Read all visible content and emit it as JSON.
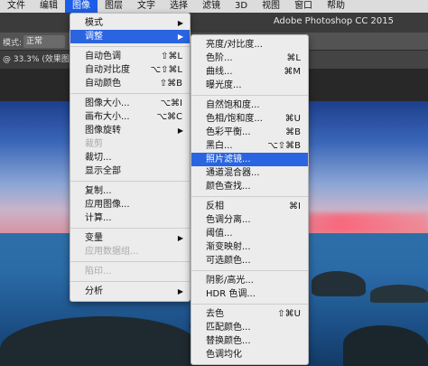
{
  "menubar": {
    "items": [
      "文件",
      "编辑",
      "图像",
      "图层",
      "文字",
      "选择",
      "滤镜",
      "3D",
      "视图",
      "窗口",
      "帮助"
    ],
    "active_index": 2
  },
  "app": {
    "title": "Adobe Photoshop CC 2015"
  },
  "options_bar": {
    "mode_label": "模式:",
    "mode_value": "正常"
  },
  "document_tab": {
    "label": "@ 33.3% (效果图层"
  },
  "image_menu": {
    "items": [
      {
        "label": "模式",
        "submenu": true
      },
      {
        "label": "调整",
        "submenu": true,
        "selected": true
      },
      {
        "sep": true
      },
      {
        "label": "自动色调",
        "shortcut": "⇧⌘L"
      },
      {
        "label": "自动对比度",
        "shortcut": "⌥⇧⌘L"
      },
      {
        "label": "自动颜色",
        "shortcut": "⇧⌘B"
      },
      {
        "sep": true
      },
      {
        "label": "图像大小...",
        "shortcut": "⌥⌘I"
      },
      {
        "label": "画布大小...",
        "shortcut": "⌥⌘C"
      },
      {
        "label": "图像旋转",
        "submenu": true
      },
      {
        "label": "裁剪",
        "disabled": true
      },
      {
        "label": "裁切..."
      },
      {
        "label": "显示全部"
      },
      {
        "sep": true
      },
      {
        "label": "复制..."
      },
      {
        "label": "应用图像..."
      },
      {
        "label": "计算..."
      },
      {
        "sep": true
      },
      {
        "label": "变量",
        "submenu": true
      },
      {
        "label": "应用数据组...",
        "disabled": true
      },
      {
        "sep": true
      },
      {
        "label": "陷印...",
        "disabled": true
      },
      {
        "sep": true
      },
      {
        "label": "分析",
        "submenu": true
      }
    ]
  },
  "adjust_menu": {
    "items": [
      {
        "label": "亮度/对比度..."
      },
      {
        "label": "色阶...",
        "shortcut": "⌘L"
      },
      {
        "label": "曲线...",
        "shortcut": "⌘M"
      },
      {
        "label": "曝光度..."
      },
      {
        "sep": true
      },
      {
        "label": "自然饱和度..."
      },
      {
        "label": "色相/饱和度...",
        "shortcut": "⌘U"
      },
      {
        "label": "色彩平衡...",
        "shortcut": "⌘B"
      },
      {
        "label": "黑白...",
        "shortcut": "⌥⇧⌘B"
      },
      {
        "label": "照片滤镜...",
        "selected": true
      },
      {
        "label": "通道混合器..."
      },
      {
        "label": "颜色查找..."
      },
      {
        "sep": true
      },
      {
        "label": "反相",
        "shortcut": "⌘I"
      },
      {
        "label": "色调分离..."
      },
      {
        "label": "阈值..."
      },
      {
        "label": "渐变映射..."
      },
      {
        "label": "可选颜色..."
      },
      {
        "sep": true
      },
      {
        "label": "阴影/高光..."
      },
      {
        "label": "HDR 色调..."
      },
      {
        "sep": true
      },
      {
        "label": "去色",
        "shortcut": "⇧⌘U"
      },
      {
        "label": "匹配颜色..."
      },
      {
        "label": "替换颜色..."
      },
      {
        "label": "色调均化"
      }
    ]
  },
  "colors": {
    "menu_highlight": "#2a64e0",
    "menubar_active": "#1d5ee8"
  }
}
